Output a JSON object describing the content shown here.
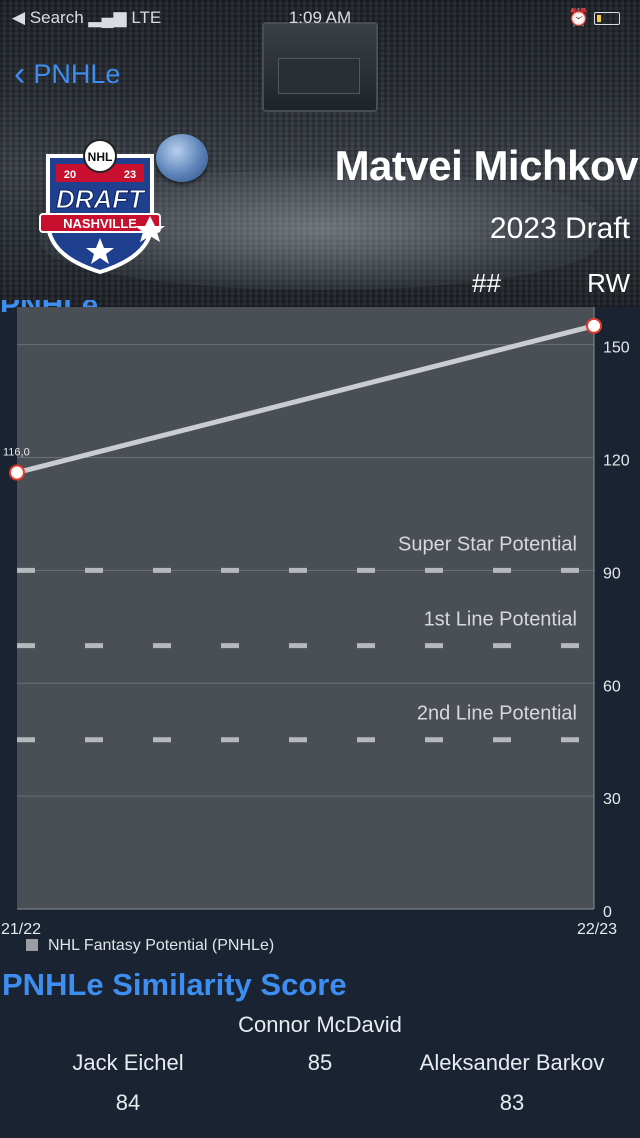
{
  "status_bar": {
    "back_app": "◀ Search",
    "carrier": "LTE",
    "time": "1:09 AM"
  },
  "nav": {
    "back_label": "PNHLe"
  },
  "player": {
    "name": "Matvei Michkov",
    "draft": "2023 Draft",
    "number": "##",
    "position": "RW"
  },
  "logo": {
    "year_left": "20",
    "year_right": "23",
    "word": "DRAFT",
    "city": "NASHVILLE",
    "league": "NHL"
  },
  "section_cut_title": "PNHLe",
  "chart_data": {
    "type": "line",
    "x": [
      "21/22",
      "22/23"
    ],
    "series": [
      {
        "name": "NHL Fantasy Potential (PNHLe)",
        "values": [
          116.0,
          155.0
        ]
      }
    ],
    "point_labels": [
      "116,0",
      ""
    ],
    "ylim": [
      0,
      160
    ],
    "y_ticks": [
      0,
      30,
      60,
      90,
      120,
      150
    ],
    "grid": true,
    "reference_lines": [
      {
        "label": "Super Star Potential",
        "value": 90
      },
      {
        "label": "1st Line Potential",
        "value": 70
      },
      {
        "label": "2nd Line Potential",
        "value": 45
      }
    ],
    "legend": "bottom-left",
    "colors": {
      "line": "#c9ccd1",
      "plot_bg": "#4a4e55",
      "marker_edge": "#e23b2e"
    }
  },
  "legend_label": "NHL Fantasy Potential (PNHLe)",
  "similarity": {
    "title": "PNHLe Similarity Score",
    "top": {
      "name": "Connor McDavid",
      "score": "85"
    },
    "left": {
      "name": "Jack Eichel",
      "score": "84"
    },
    "right": {
      "name": "Aleksander Barkov",
      "score": "83"
    }
  },
  "colors": {
    "accent": "#3d8ef0",
    "background": "#1a2332"
  }
}
